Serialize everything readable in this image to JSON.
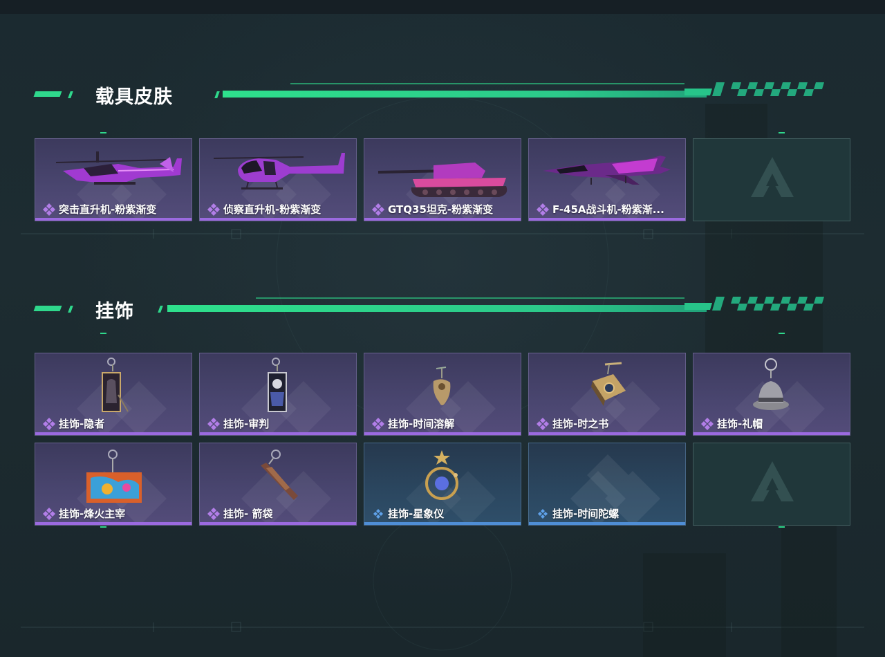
{
  "sections": [
    {
      "title": "载具皮肤",
      "items": [
        {
          "label": "突击直升机-粉紫渐变",
          "rarity": "purple",
          "icon": "attack-helicopter-icon"
        },
        {
          "label": "侦察直升机-粉紫渐变",
          "rarity": "purple",
          "icon": "scout-helicopter-icon"
        },
        {
          "label": "GTQ35坦克-粉紫渐变",
          "rarity": "purple",
          "icon": "tank-icon"
        },
        {
          "label": "F-45A战斗机-粉紫渐...",
          "rarity": "purple",
          "icon": "fighter-jet-icon"
        },
        {
          "label": "",
          "rarity": "empty",
          "icon": "empty-slot-logo-icon"
        }
      ]
    },
    {
      "title": "挂饰",
      "items": [
        {
          "label": "挂饰-隐者",
          "rarity": "purple",
          "icon": "hermit-card-charm-icon"
        },
        {
          "label": "挂饰-审判",
          "rarity": "purple",
          "icon": "judgment-card-charm-icon"
        },
        {
          "label": "挂饰-时间溶解",
          "rarity": "purple",
          "icon": "melting-clock-charm-icon"
        },
        {
          "label": "挂饰-时之书",
          "rarity": "purple",
          "icon": "book-of-time-charm-icon"
        },
        {
          "label": "挂饰-礼帽",
          "rarity": "purple",
          "icon": "top-hat-charm-icon"
        },
        {
          "label": "挂饰-烽火主宰",
          "rarity": "purple",
          "icon": "graffiti-container-charm-icon"
        },
        {
          "label": "挂饰- 箭袋",
          "rarity": "purple",
          "icon": "quiver-charm-icon"
        },
        {
          "label": "挂饰-星象仪",
          "rarity": "blue",
          "icon": "astrolabe-charm-icon"
        },
        {
          "label": "挂饰-时间陀螺",
          "rarity": "blue",
          "icon": "time-gyroscope-charm-icon"
        },
        {
          "label": "",
          "rarity": "empty",
          "icon": "empty-slot-logo-icon"
        }
      ]
    }
  ],
  "colors": {
    "accent": "#2fd88c",
    "purple_rarity": "#9b6ae0",
    "blue_rarity": "#4f8ed6"
  }
}
